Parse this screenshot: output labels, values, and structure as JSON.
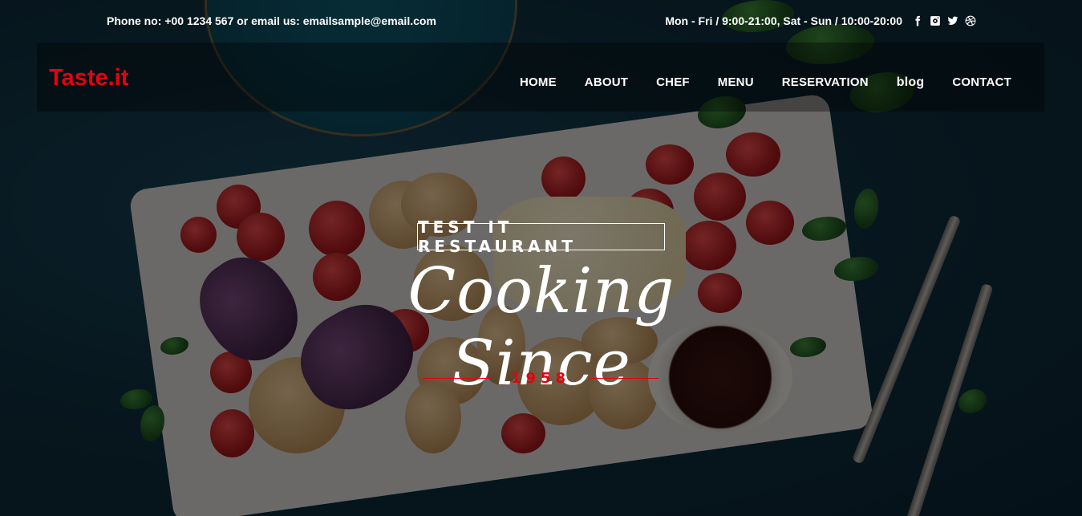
{
  "topbar": {
    "contact_text": "Phone no: +00 1234 567 or email us: emailsample@email.com",
    "hours_text": "Mon - Fri / 9:00-21:00, Sat - Sun / 10:00-20:00",
    "social_icons": [
      "facebook-icon",
      "instagram-icon",
      "twitter-icon",
      "dribbble-icon"
    ]
  },
  "navbar": {
    "brand": "Taste.it",
    "brand_color": "#e8000d",
    "items": [
      {
        "label": "HOME"
      },
      {
        "label": "ABOUT"
      },
      {
        "label": "CHEF"
      },
      {
        "label": "MENU"
      },
      {
        "label": "RESERVATION"
      },
      {
        "label": "blog"
      },
      {
        "label": "CONTACT"
      }
    ]
  },
  "hero": {
    "tagline": "TEST IT RESTAURANT",
    "title": "Cooking Since",
    "year": "1958",
    "accent_color": "#e8000d"
  }
}
